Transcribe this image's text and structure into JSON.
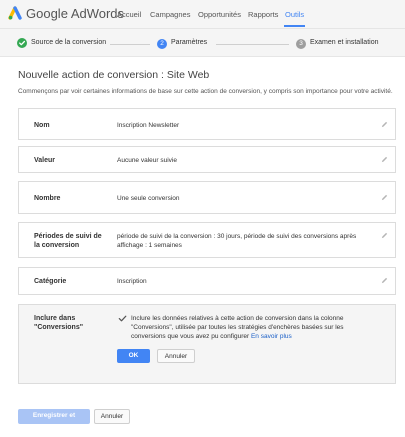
{
  "app": {
    "product": "Google AdWords",
    "nav": [
      "Accueil",
      "Campagnes",
      "Opportunités",
      "Rapports",
      "Outils"
    ],
    "active_nav": "Outils"
  },
  "steps": [
    {
      "number": "",
      "label": "Source de la conversion",
      "status": "done"
    },
    {
      "number": "2",
      "label": "Paramètres",
      "status": "active"
    },
    {
      "number": "3",
      "label": "Examen et installation",
      "status": "pending"
    }
  ],
  "page": {
    "title": "Nouvelle action de conversion : Site Web",
    "intro": "Commençons par voir certaines informations de base sur cette action de conversion, y compris son importance pour votre activité."
  },
  "fields": {
    "nom": {
      "label": "Nom",
      "value": "Inscription Newsletter"
    },
    "valeur": {
      "label": "Valeur",
      "value": "Aucune valeur suivie"
    },
    "nombre": {
      "label": "Nombre",
      "value": "Une seule conversion"
    },
    "periodes": {
      "label_line1": "Périodes de suivi de",
      "label_line2": "la conversion",
      "value": "période de suivi de la conversion : 30 jours, période de suivi des conversions après affichage : 1 semaines"
    },
    "categorie": {
      "label": "Catégorie",
      "value": "Inscription"
    }
  },
  "include_panel": {
    "label_line1": "Inclure dans",
    "label_line2": "\"Conversions\"",
    "checked": true,
    "text": "Inclure les données relatives à cette action de conversion dans la colonne \"Conversions\", utilisée par toutes les stratégies d'enchères basées sur les conversions que vous avez pu configurer",
    "link": "En savoir plus",
    "ok_label": "OK",
    "cancel_label": "Annuler"
  },
  "footer": {
    "save_label": "Enregistrer et continuer",
    "cancel_label": "Annuler"
  },
  "colors": {
    "accent": "#4285f4",
    "done_green": "#34a853",
    "pending_gray": "#9e9e9e",
    "panel_bg": "#f5f5f5"
  }
}
